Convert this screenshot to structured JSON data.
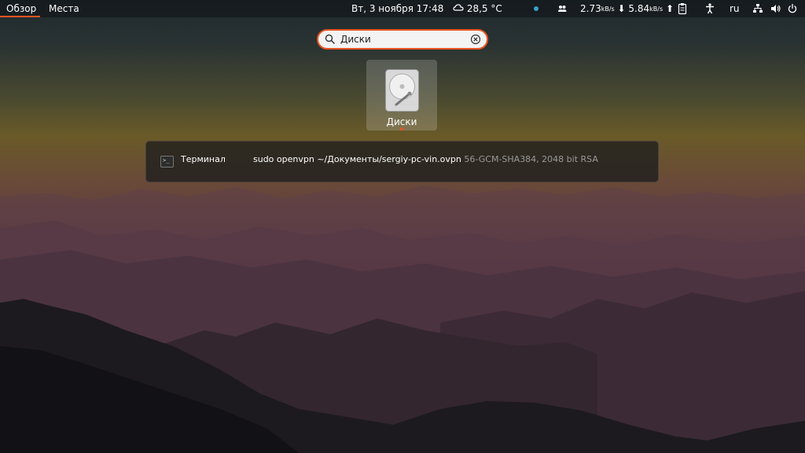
{
  "topbar": {
    "activities": "Обзор",
    "places": "Места",
    "clock": "Вт, 3 ноября  17:48",
    "weather": "28,5 °C",
    "net_down_value": "2.73",
    "net_down_unit": "kB/s",
    "net_up_value": "5.84",
    "net_up_unit": "kB/s",
    "keyboard_layout": "ru"
  },
  "search": {
    "value": "Диски"
  },
  "app_results": [
    {
      "label": "Диски"
    }
  ],
  "provider_results": {
    "app_name": "Терминал",
    "command": "sudo openvpn ~/Документы/sergiy-pc-vin.ovpn",
    "detail": "56-GCM-SHA384, 2048 bit RSA"
  },
  "colors": {
    "accent": "#e95420",
    "panel": "#0e1012"
  }
}
